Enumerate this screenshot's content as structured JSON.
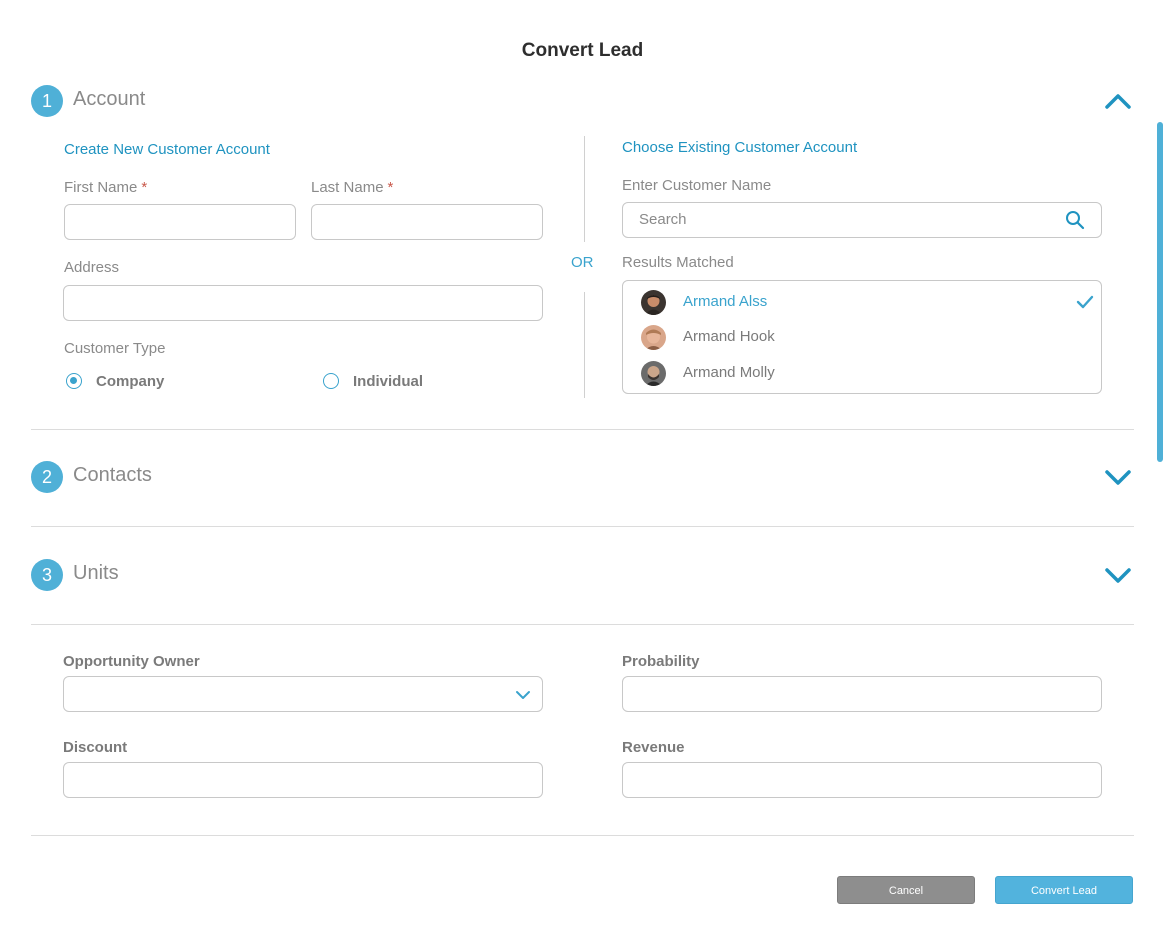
{
  "dialog": {
    "title": "Convert Lead"
  },
  "sections": [
    {
      "number": "1",
      "title": "Account",
      "expanded": true
    },
    {
      "number": "2",
      "title": "Contacts",
      "expanded": false
    },
    {
      "number": "3",
      "title": "Units",
      "expanded": false
    }
  ],
  "account": {
    "new_heading": "Create New Customer Account",
    "first_name_label": "First Name",
    "last_name_label": "Last Name",
    "required_mark": "*",
    "address_label": "Address",
    "customer_type_label": "Customer Type",
    "customer_types": [
      {
        "label": "Company",
        "selected": true
      },
      {
        "label": "Individual",
        "selected": false
      }
    ],
    "or_text": "OR",
    "existing_heading": "Choose Existing Customer Account",
    "customer_name_label": "Enter Customer Name",
    "search_placeholder": "Search",
    "results_label": "Results Matched",
    "results": [
      {
        "name": "Armand Alss",
        "selected": true
      },
      {
        "name": "Armand Hook",
        "selected": false
      },
      {
        "name": "Armand Molly",
        "selected": false
      }
    ]
  },
  "opportunity": {
    "owner_label": "Opportunity Owner",
    "probability_label": "Probability",
    "discount_label": "Discount",
    "revenue_label": "Revenue"
  },
  "buttons": {
    "cancel": "Cancel",
    "convert": "Convert Lead"
  },
  "colors": {
    "accent": "#4fb0d7",
    "link": "#1f93c0",
    "required": "#c9584a",
    "cancel": "#8e8e8e"
  },
  "icons": {
    "search": "search-icon",
    "check": "check-icon",
    "chevron_up": "chevron-up-icon",
    "chevron_down": "chevron-down-icon"
  }
}
